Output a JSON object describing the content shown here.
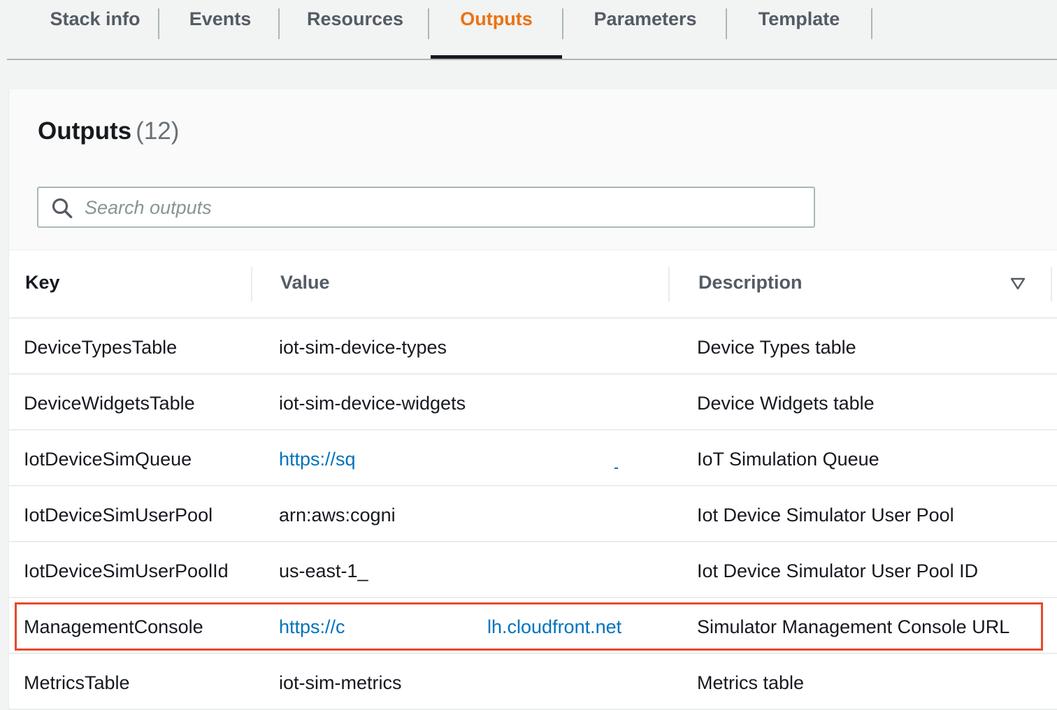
{
  "tabs": [
    {
      "label": "Stack info",
      "active": false
    },
    {
      "label": "Events",
      "active": false
    },
    {
      "label": "Resources",
      "active": false
    },
    {
      "label": "Outputs",
      "active": true
    },
    {
      "label": "Parameters",
      "active": false
    },
    {
      "label": "Template",
      "active": false
    }
  ],
  "panel": {
    "title": "Outputs",
    "count": "(12)"
  },
  "search": {
    "placeholder": "Search outputs",
    "icon": "search-icon"
  },
  "table": {
    "columns": [
      "Key",
      "Value",
      "Description"
    ],
    "sort_icon": "sort-desc-icon",
    "rows": [
      {
        "key": "DeviceTypesTable",
        "value": "iot-sim-device-types",
        "value_suffix": "",
        "description": "Device Types table",
        "is_link": false
      },
      {
        "key": "DeviceWidgetsTable",
        "value": "iot-sim-device-widgets",
        "value_suffix": "",
        "description": "Device Widgets table",
        "is_link": false
      },
      {
        "key": "IotDeviceSimQueue",
        "value": "https://sq",
        "value_suffix": "",
        "description": "IoT Simulation Queue",
        "is_link": true
      },
      {
        "key": "IotDeviceSimUserPool",
        "value": "arn:aws:cogni",
        "value_suffix": "",
        "description": "Iot Device Simulator User Pool",
        "is_link": false
      },
      {
        "key": "IotDeviceSimUserPoolId",
        "value": "us-east-1_",
        "value_suffix": "",
        "description": "Iot Device Simulator User Pool ID",
        "is_link": false
      },
      {
        "key": "ManagementConsole",
        "value": "https://c",
        "value_suffix": "lh.cloudfront.net",
        "description": "Simulator Management Console URL",
        "is_link": true
      },
      {
        "key": "MetricsTable",
        "value": "iot-sim-metrics",
        "value_suffix": "",
        "description": "Metrics table",
        "is_link": false
      }
    ]
  },
  "colors": {
    "accent": "#ec7211",
    "link": "#0073bb",
    "highlight": "#e8492b"
  }
}
